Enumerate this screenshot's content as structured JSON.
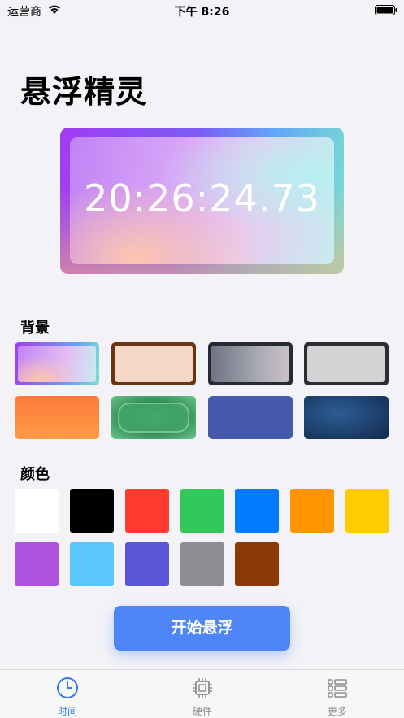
{
  "status_bar": {
    "carrier": "运营商",
    "time": "下午 8:26"
  },
  "page": {
    "title": "悬浮精灵"
  },
  "preview": {
    "time": "20:26:24.73"
  },
  "sections": {
    "background_label": "背景",
    "color_label": "颜色"
  },
  "backgrounds": [
    {
      "name": "gradient-purple",
      "selected": true
    },
    {
      "name": "wood-frame-cream"
    },
    {
      "name": "dark-frame-gray-gradient"
    },
    {
      "name": "dark-frame-light-gray"
    },
    {
      "name": "orange-gradient"
    },
    {
      "name": "green-pattern"
    },
    {
      "name": "indigo-solid"
    },
    {
      "name": "blue-texture"
    }
  ],
  "colors": [
    "#ffffff",
    "#000000",
    "#ff3b30",
    "#34c759",
    "#007aff",
    "#ff9500",
    "#ffcc00",
    "#af52de",
    "#5ac8fa",
    "#5856d6",
    "#8e8e93",
    "#8b3a06"
  ],
  "actions": {
    "start_label": "开始悬浮"
  },
  "tabs": [
    {
      "label": "时间",
      "icon": "clock-icon",
      "active": true
    },
    {
      "label": "硬件",
      "icon": "chip-icon",
      "active": false
    },
    {
      "label": "更多",
      "icon": "list-icon",
      "active": false
    }
  ]
}
